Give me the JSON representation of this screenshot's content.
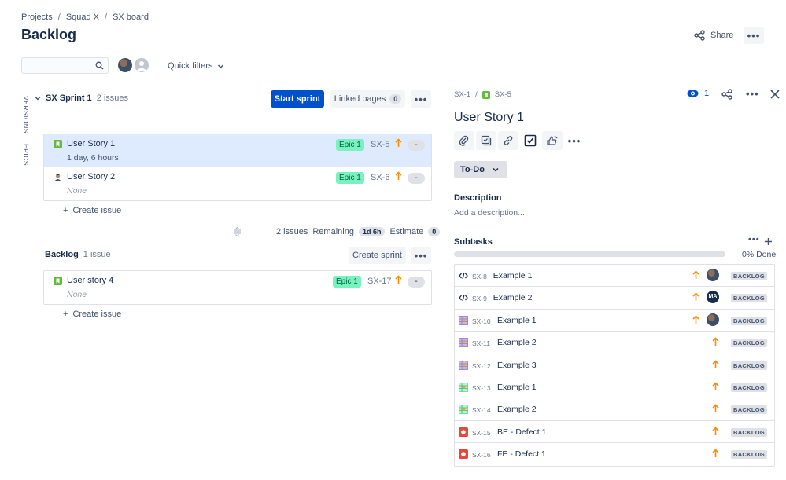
{
  "breadcrumb": [
    "Projects",
    "Squad X",
    "SX board"
  ],
  "page_title": "Backlog",
  "header": {
    "share_label": "Share",
    "more_label": "•••"
  },
  "filters": {
    "search_placeholder": "",
    "quick_filters_label": "Quick filters"
  },
  "side_tabs": {
    "versions": "VERSIONS",
    "epics": "EPICS"
  },
  "sprint": {
    "name": "SX Sprint 1",
    "issue_count": "2 issues",
    "start_label": "Start sprint",
    "linked_pages_label": "Linked pages",
    "linked_pages_count": "0",
    "issues": [
      {
        "title": "User Story 1",
        "sub": "1 day, 6 hours",
        "epic": "Epic 1",
        "key": "SX-5",
        "estimate": "-",
        "icon": "story-icon"
      },
      {
        "title": "User Story 2",
        "sub": "None",
        "epic": "Epic 1",
        "key": "SX-6",
        "estimate": "-",
        "icon": "user-avatar-icon"
      }
    ],
    "create_issue_label": "Create issue",
    "summary": {
      "issues": "2 issues",
      "remaining_label": "Remaining",
      "remaining_value": "1d 6h",
      "estimate_label": "Estimate",
      "estimate_value": "0"
    }
  },
  "backlog": {
    "name": "Backlog",
    "issue_count": "1 issue",
    "create_sprint_label": "Create sprint",
    "issues": [
      {
        "title": "User story 4",
        "sub": "None",
        "epic": "Epic 1",
        "key": "SX-17",
        "estimate": "-",
        "icon": "story-icon"
      }
    ],
    "create_issue_label": "Create issue"
  },
  "detail": {
    "parent_key": "SX-1",
    "key": "SX-5",
    "watch_count": "1",
    "title": "User Story 1",
    "status": "To-Do",
    "description_label": "Description",
    "description_placeholder": "Add a description...",
    "subtasks_label": "Subtasks",
    "progress_label": "0% Done",
    "progress_fraction": 0,
    "subtasks": [
      {
        "key": "SX-8",
        "title": "Example 1",
        "type": "code-icon",
        "avatar": "photo",
        "status": "BACKLOG"
      },
      {
        "key": "SX-9",
        "title": "Example 2",
        "type": "code-icon",
        "avatar": "MA",
        "status": "BACKLOG"
      },
      {
        "key": "SX-10",
        "title": "Example 1",
        "type": "table-icon",
        "avatar": "photo",
        "status": "BACKLOG"
      },
      {
        "key": "SX-11",
        "title": "Example 2",
        "type": "table-icon",
        "avatar": "",
        "status": "BACKLOG"
      },
      {
        "key": "SX-12",
        "title": "Example 3",
        "type": "table-icon",
        "avatar": "",
        "status": "BACKLOG"
      },
      {
        "key": "SX-13",
        "title": "Example 1",
        "type": "table-green-icon",
        "avatar": "",
        "status": "BACKLOG"
      },
      {
        "key": "SX-14",
        "title": "Example 2",
        "type": "table-green-icon",
        "avatar": "",
        "status": "BACKLOG"
      },
      {
        "key": "SX-15",
        "title": "BE - Defect 1",
        "type": "bug-icon",
        "avatar": "",
        "status": "BACKLOG"
      },
      {
        "key": "SX-16",
        "title": "FE - Defect 1",
        "type": "bug-icon",
        "avatar": "",
        "status": "BACKLOG"
      }
    ]
  },
  "colors": {
    "primary": "#0052cc",
    "epic_bg": "#79f2c0",
    "priority": "#ff8b00",
    "story": "#63ba3c",
    "bug": "#e5493a",
    "selected_row": "#deebff"
  }
}
